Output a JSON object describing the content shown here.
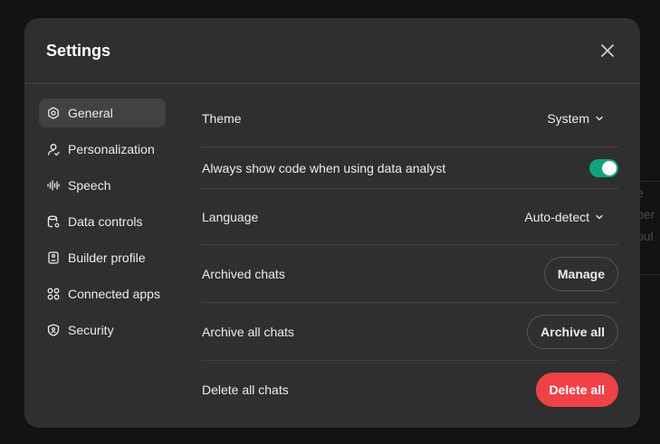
{
  "background": {
    "peek_lines": [
      "e",
      "per",
      "oul"
    ]
  },
  "modal": {
    "title": "Settings"
  },
  "sidebar": {
    "items": [
      {
        "label": "General",
        "icon": "gear-icon",
        "active": true
      },
      {
        "label": "Personalization",
        "icon": "person-icon"
      },
      {
        "label": "Speech",
        "icon": "waveform-icon"
      },
      {
        "label": "Data controls",
        "icon": "database-icon"
      },
      {
        "label": "Builder profile",
        "icon": "badge-icon"
      },
      {
        "label": "Connected apps",
        "icon": "grid-icon"
      },
      {
        "label": "Security",
        "icon": "shield-icon"
      }
    ]
  },
  "general": {
    "theme": {
      "label": "Theme",
      "value": "System"
    },
    "code": {
      "label": "Always show code when using data analyst",
      "enabled": true
    },
    "language": {
      "label": "Language",
      "value": "Auto-detect"
    },
    "archived": {
      "label": "Archived chats",
      "button": "Manage"
    },
    "archive_all": {
      "label": "Archive all chats",
      "button": "Archive all"
    },
    "delete_all": {
      "label": "Delete all chats",
      "button": "Delete all"
    }
  },
  "colors": {
    "accent_toggle": "#10a37f",
    "danger": "#ef4146",
    "modal_bg": "#2f2f2f"
  }
}
